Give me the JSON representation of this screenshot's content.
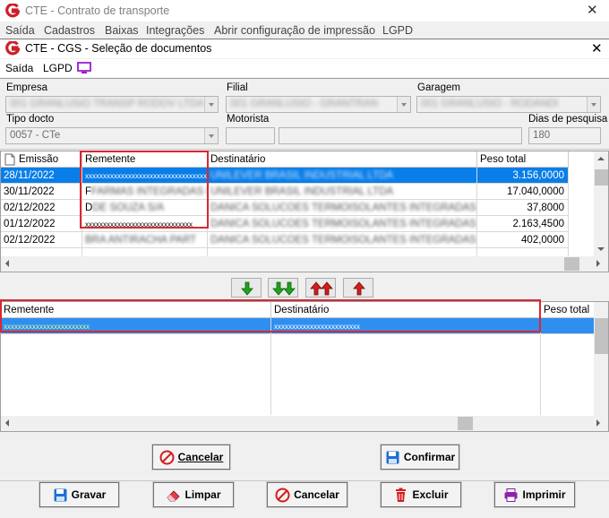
{
  "outer_window": {
    "title": "CTE - Contrato de transporte",
    "close_glyph": "✕",
    "menu": [
      "Saída",
      "Cadastros",
      "Baixas",
      "Integrações",
      "Abrir configuração de impressão",
      "LGPD"
    ]
  },
  "inner_window": {
    "title": "CTE - CGS - Seleção de documentos",
    "close_glyph": "✕",
    "menu": [
      "Saída",
      "LGPD"
    ]
  },
  "filters": {
    "empresa_label": "Empresa",
    "empresa_value": "001 GRANLUSIO TRANSP RODOV LTDA",
    "filial_label": "Filial",
    "filial_value": "001 GRANLUSIO - GRANTRAN",
    "garagem_label": "Garagem",
    "garagem_value": "001 GRANLUSIO - RODANDI",
    "tipo_docto_label": "Tipo docto",
    "tipo_docto_value": "0057 - CTe",
    "motorista_label": "Motorista",
    "motorista_code": "",
    "motorista_name": "",
    "dias_label": "Dias de pesquisa",
    "dias_value": "180"
  },
  "top_grid": {
    "columns": [
      "Emissão",
      "Remetente",
      "Destinatário",
      "Peso total"
    ],
    "rows": [
      {
        "emissao": "28/11/2022",
        "remetente": "xxxxxxxxxxxxxxxxxxxxxxxxxxxxxxxxxx",
        "destinatario": "UNILEVER BRASIL INDUSTRIAL LTDA",
        "peso": "3.156,0000"
      },
      {
        "emissao": "30/11/2022",
        "remetente": "F",
        "remetente_blur": "FARMAS INTEGRADAS LTDA",
        "destinatario": "UNILEVER BRASIL INDUSTRIAL LTDA",
        "peso": "17.040,0000"
      },
      {
        "emissao": "02/12/2022",
        "remetente": "D",
        "remetente_blur": "DE SOUZA S/A",
        "destinatario": "DANICA SOLUCOES TERMOISOLANTES INTEGRADAS S",
        "peso": "37,8000"
      },
      {
        "emissao": "01/12/2022",
        "remetente": "xxxxxxxxxxxxxxxxxxxxxxxxxxxxxx",
        "destinatario": "DANICA SOLUCOES TERMOISOLANTES INTEGRADAS S",
        "peso": "2.163,4500"
      },
      {
        "emissao": "02/12/2022",
        "remetente": "",
        "remetente_blur": "BRA ANTIRACHA PART",
        "destinatario": "DANICA SOLUCOES TERMOISOLANTES INTEGRADAS S",
        "peso": "402,0000"
      }
    ]
  },
  "bottom_grid": {
    "columns": [
      "Remetente",
      "Destinatário",
      "Peso total"
    ],
    "rows": [
      {
        "remetente": "xxxxxxxxxxxxxxxxxxxxxxxx",
        "destinatario": "xxxxxxxxxxxxxxxxxxxxxxxx",
        "peso": ""
      }
    ]
  },
  "buttons": {
    "cancelar_top": "Cancelar",
    "confirmar": "Confirmar",
    "gravar": "Gravar",
    "limpar": "Limpar",
    "cancelar": "Cancelar",
    "excluir": "Excluir",
    "imprimir": "Imprimir"
  },
  "colors": {
    "selection": "#0a7ee8",
    "highlight_box": "#d9282f",
    "brand_logo": "#cc1f2b",
    "green_arrow": "#1fa21f",
    "red_arrow": "#d41c1c"
  },
  "icons": {
    "logo": "brand-g-logo",
    "document_header": "document-icon",
    "monitor": "monitor-icon",
    "move_down": "arrow-down-icon",
    "move_all_down": "double-arrow-down-icon",
    "move_all_up": "double-arrow-up-icon",
    "move_up": "arrow-up-icon",
    "cancel": "cancel-icon",
    "save": "floppy-disk-icon",
    "clear": "eraser-icon",
    "delete": "trash-icon",
    "print": "printer-icon"
  }
}
